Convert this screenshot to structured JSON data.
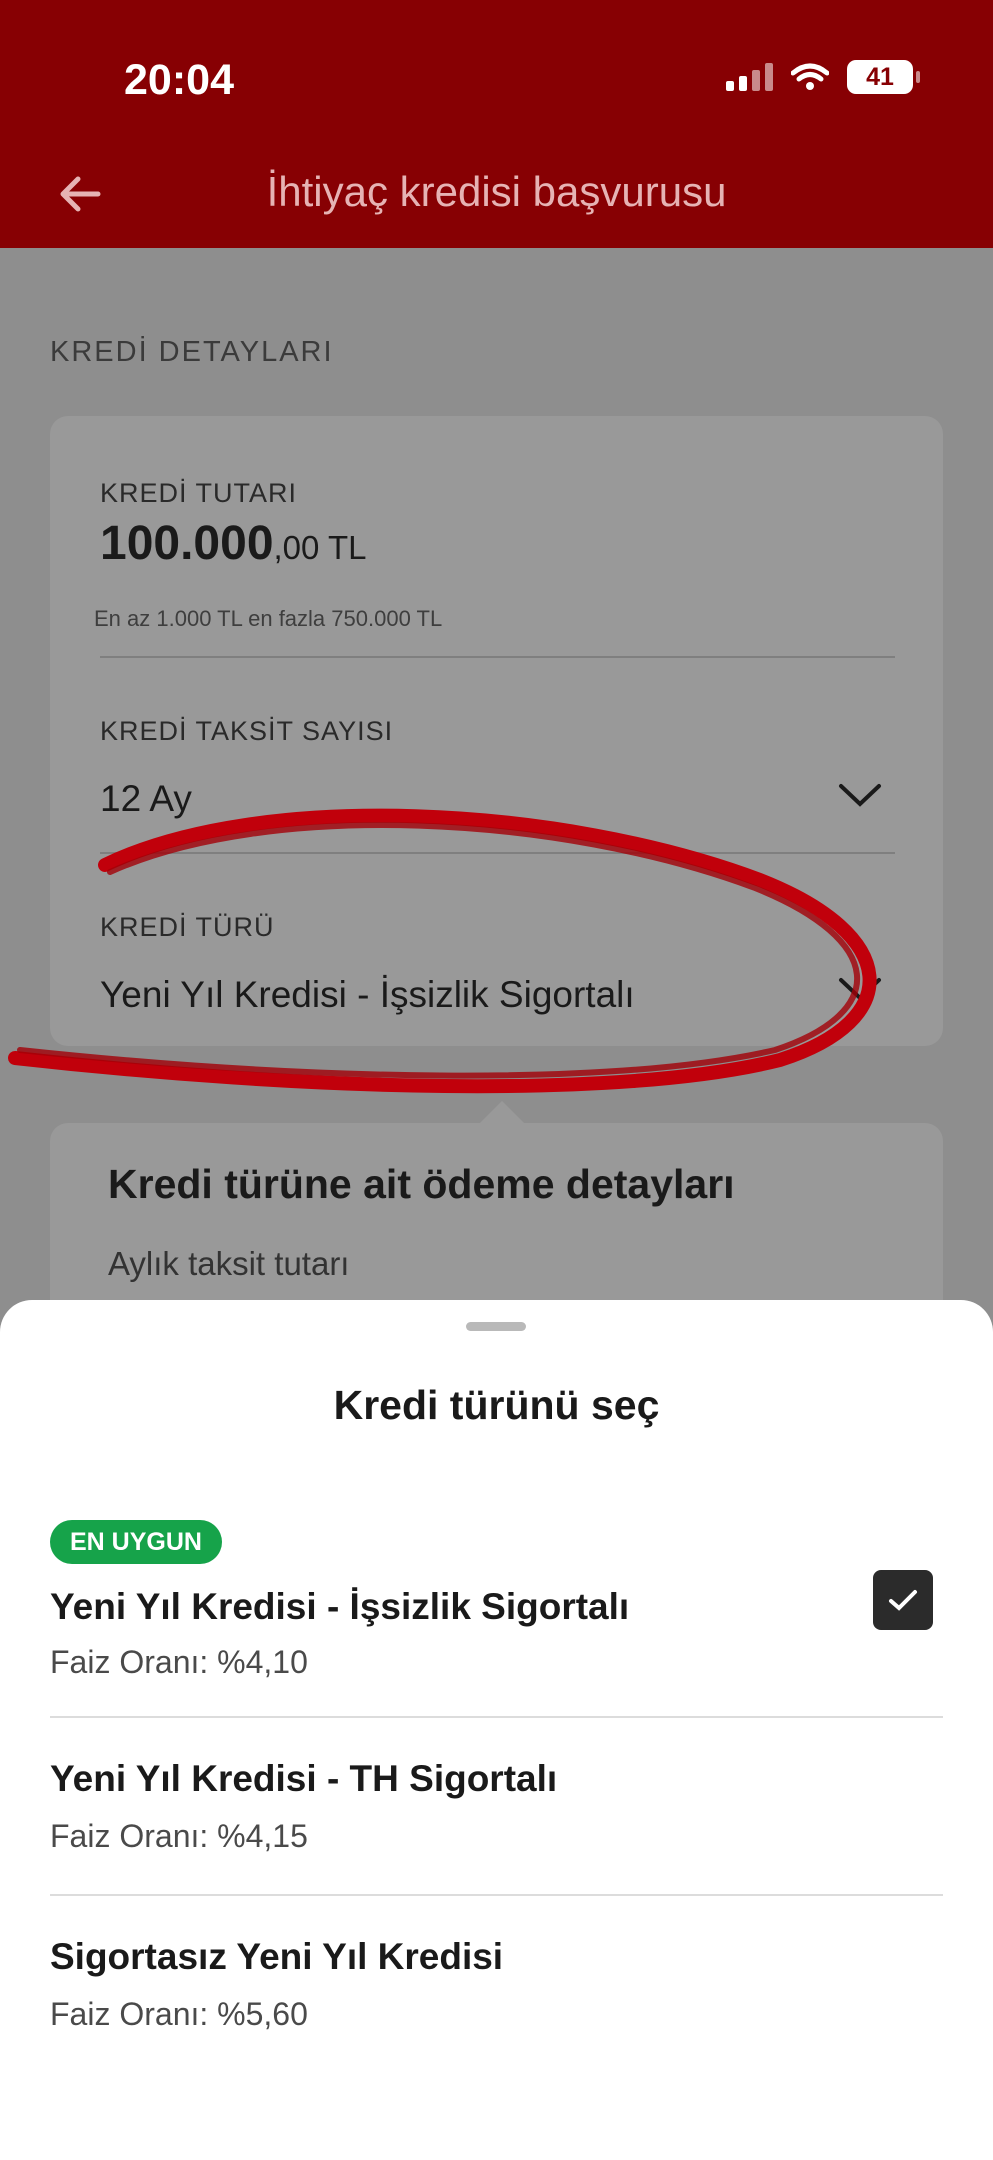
{
  "status_bar": {
    "time": "20:04",
    "battery": "41"
  },
  "header": {
    "title": "İhtiyaç kredisi başvurusu"
  },
  "main": {
    "section_title": "KREDİ DETAYLARI",
    "amount": {
      "label": "KREDİ TUTARI",
      "value_main": "100.000",
      "value_decimal": ",00 TL",
      "hint": "En az 1.000 TL en fazla 750.000 TL"
    },
    "installments": {
      "label": "KREDİ TAKSİT SAYISI",
      "value": "12 Ay"
    },
    "credit_type": {
      "label": "KREDİ TÜRÜ",
      "value": "Yeni Yıl Kredisi - İşsizlik Sigortalı"
    },
    "payment_details": {
      "title": "Kredi türüne ait ödeme detayları",
      "monthly_label": "Aylık taksit tutarı"
    }
  },
  "sheet": {
    "title": "Kredi türünü seç",
    "options": [
      {
        "badge": "EN UYGUN",
        "name": "Yeni Yıl Kredisi - İşsizlik Sigortalı",
        "rate": "Faiz Oranı: %4,10",
        "selected": true
      },
      {
        "name": "Yeni Yıl Kredisi - TH Sigortalı",
        "rate": "Faiz Oranı: %4,15",
        "selected": false
      },
      {
        "name": "Sigortasız Yeni Yıl Kredisi",
        "rate": "Faiz Oranı: %5,60",
        "selected": false
      }
    ]
  },
  "colors": {
    "brand_red": "#870003",
    "badge_green": "#16a34a",
    "annotation_red": "#c1000b"
  }
}
